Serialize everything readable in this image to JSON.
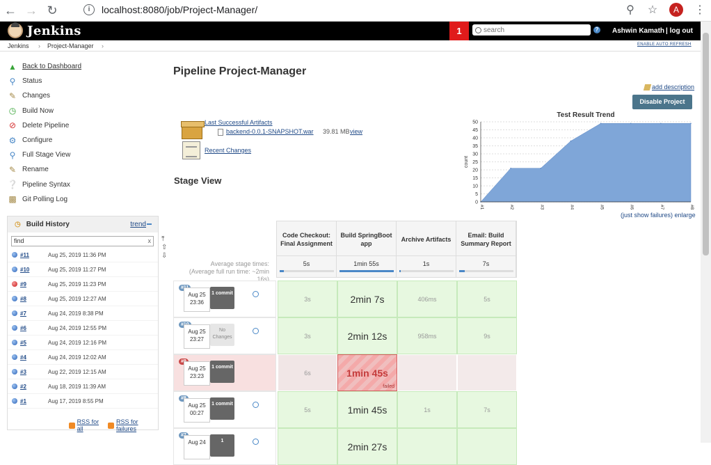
{
  "browser": {
    "url": "localhost:8080/job/Project-Manager/",
    "avatar_letter": "A"
  },
  "header": {
    "logo_text": "Jenkins",
    "notifications": "1",
    "search_placeholder": "search",
    "user": "Ashwin Kamath",
    "logout": "| log out"
  },
  "breadcrumb": {
    "items": [
      "Jenkins",
      "›",
      "Project-Manager",
      "›"
    ],
    "auto_refresh": "ENABLE AUTO REFRESH"
  },
  "sidebar": {
    "items": [
      {
        "label": "Back to Dashboard",
        "icon": "up-arrow-icon"
      },
      {
        "label": "Status",
        "icon": "magnifier-icon"
      },
      {
        "label": "Changes",
        "icon": "notepad-icon"
      },
      {
        "label": "Build Now",
        "icon": "clock-play-icon"
      },
      {
        "label": "Delete Pipeline",
        "icon": "no-entry-icon"
      },
      {
        "label": "Configure",
        "icon": "gear-icon"
      },
      {
        "label": "Full Stage View",
        "icon": "magnifier-icon"
      },
      {
        "label": "Rename",
        "icon": "notepad-icon"
      },
      {
        "label": "Pipeline Syntax",
        "icon": "help-icon"
      },
      {
        "label": "Git Polling Log",
        "icon": "clipboard-icon"
      }
    ]
  },
  "build_history": {
    "title": "Build History",
    "trend": "trend",
    "find": "find",
    "builds": [
      {
        "num": "#11",
        "date": "Aug 25, 2019 11:36 PM",
        "status": "blue"
      },
      {
        "num": "#10",
        "date": "Aug 25, 2019 11:27 PM",
        "status": "blue"
      },
      {
        "num": "#9",
        "date": "Aug 25, 2019 11:23 PM",
        "status": "red"
      },
      {
        "num": "#8",
        "date": "Aug 25, 2019 12:27 AM",
        "status": "blue"
      },
      {
        "num": "#7",
        "date": "Aug 24, 2019 8:38 PM",
        "status": "blue"
      },
      {
        "num": "#6",
        "date": "Aug 24, 2019 12:55 PM",
        "status": "blue"
      },
      {
        "num": "#5",
        "date": "Aug 24, 2019 12:16 PM",
        "status": "blue"
      },
      {
        "num": "#4",
        "date": "Aug 24, 2019 12:02 AM",
        "status": "blue"
      },
      {
        "num": "#3",
        "date": "Aug 22, 2019 12:15 AM",
        "status": "blue"
      },
      {
        "num": "#2",
        "date": "Aug 18, 2019 11:39 AM",
        "status": "blue"
      },
      {
        "num": "#1",
        "date": "Aug 17, 2019 8:55 PM",
        "status": "blue"
      }
    ],
    "rss_all": "RSS for all",
    "rss_failures": "RSS for failures"
  },
  "main": {
    "title": "Pipeline Project-Manager",
    "add_description": "add description",
    "disable_button": "Disable Project",
    "last_artifacts": "Last Successful Artifacts",
    "artifact_file": "backend-0.0.1-SNAPSHOT.war",
    "artifact_size": "39.81 MB",
    "artifact_view": "view",
    "recent_changes": "Recent Changes",
    "stage_view_title": "Stage View",
    "just_show_failures": "(just show failures)",
    "enlarge": "enlarge"
  },
  "chart_data": {
    "type": "area",
    "title": "Test Result Trend",
    "ylabel": "count",
    "x": [
      "#1",
      "#2",
      "#3",
      "#4",
      "#5",
      "#6",
      "#7",
      "#8"
    ],
    "values": [
      0,
      21,
      21,
      38,
      49,
      49,
      49,
      49
    ],
    "ylim": [
      0,
      50
    ],
    "yticks": [
      0,
      5,
      10,
      15,
      20,
      25,
      30,
      35,
      40,
      45,
      50
    ],
    "color": "#7fa6d8",
    "grid": true
  },
  "stage_view": {
    "stages": [
      {
        "name": "Code Checkout: Final Assignment",
        "avg": "5s",
        "avg_pct": 8
      },
      {
        "name": "Build SpringBoot app",
        "avg": "1min 55s",
        "avg_pct": 100
      },
      {
        "name": "Archive Artifacts",
        "avg": "1s",
        "avg_pct": 2
      },
      {
        "name": "Email: Build Summary Report",
        "avg": "7s",
        "avg_pct": 10
      }
    ],
    "avg_label_1": "Average stage times:",
    "avg_label_2": "(Average full run time: ~2min",
    "avg_label_3": "16s)",
    "rows": [
      {
        "num": "#11",
        "date": "Aug 25",
        "time": "23:36",
        "commit": "1 commit",
        "failed": false,
        "cells": [
          {
            "v": "3s",
            "s": "ok"
          },
          {
            "v": "2min 7s",
            "s": "ok big"
          },
          {
            "v": "406ms",
            "s": "ok"
          },
          {
            "v": "5s",
            "s": "ok"
          }
        ]
      },
      {
        "num": "#10",
        "date": "Aug 25",
        "time": "23:27",
        "commit": "No Changes",
        "failed": false,
        "cells": [
          {
            "v": "3s",
            "s": "ok"
          },
          {
            "v": "2min 12s",
            "s": "ok big"
          },
          {
            "v": "958ms",
            "s": "ok"
          },
          {
            "v": "9s",
            "s": "ok"
          }
        ]
      },
      {
        "num": "#9",
        "date": "Aug 25",
        "time": "23:23",
        "commit": "1 commit",
        "failed": true,
        "cells": [
          {
            "v": "6s",
            "s": "gray"
          },
          {
            "v": "1min 45s",
            "s": "fail",
            "tag": "failed"
          },
          {
            "v": "",
            "s": "empty"
          },
          {
            "v": "",
            "s": "empty"
          }
        ]
      },
      {
        "num": "#8",
        "date": "Aug 25",
        "time": "00:27",
        "commit": "1 commit",
        "failed": false,
        "cells": [
          {
            "v": "5s",
            "s": "ok"
          },
          {
            "v": "1min 45s",
            "s": "ok big"
          },
          {
            "v": "1s",
            "s": "ok"
          },
          {
            "v": "7s",
            "s": "ok"
          }
        ]
      },
      {
        "num": "#7",
        "date": "Aug 24",
        "time": "",
        "commit": "1",
        "failed": false,
        "cells": [
          {
            "v": "",
            "s": "ok"
          },
          {
            "v": "2min 27s",
            "s": "ok big"
          },
          {
            "v": "",
            "s": "ok"
          },
          {
            "v": "",
            "s": "ok"
          }
        ]
      }
    ]
  }
}
